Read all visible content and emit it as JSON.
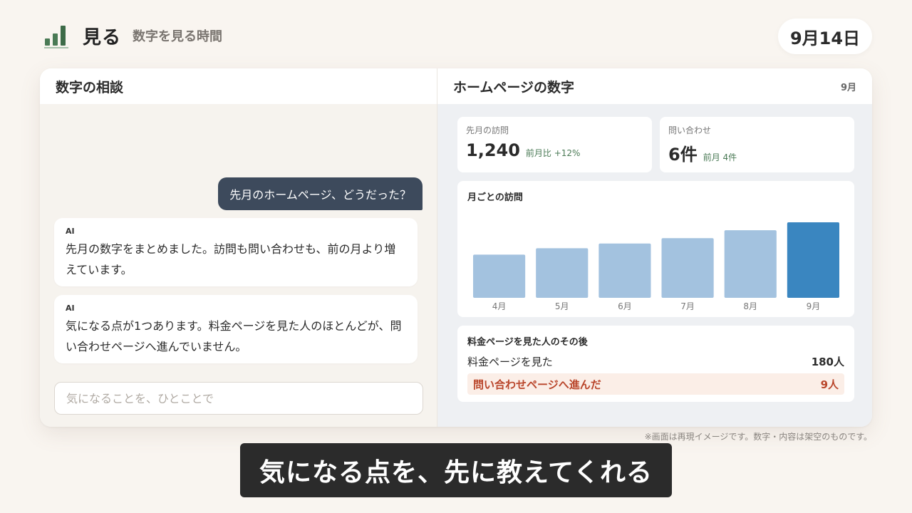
{
  "app": {
    "icon": "bar-chart-icon",
    "title": "見る",
    "subtitle": "数字を見る時間",
    "date": "9月14日"
  },
  "chat": {
    "header": "数字の相談",
    "user_message": "先月のホームページ、どうだった？",
    "ai_messages": [
      {
        "label": "AI",
        "text": "先月の数字をまとめました。訪問も問い合わせも、前の月より増えています。"
      },
      {
        "label": "AI",
        "text": "気になる点が1つあります。料金ページを見た人のほとんどが、問い合わせページへ進んでいません。"
      }
    ],
    "input_placeholder": "気になることを、ひとことで",
    "input_value": ""
  },
  "dashboard": {
    "title": "ホームページの数字",
    "month": "9月",
    "stats": [
      {
        "label": "先月の訪問",
        "value": "1,240",
        "delta": "前月比 +12%"
      },
      {
        "label": "問い合わせ",
        "value": "6件",
        "delta": "前月 4件"
      }
    ],
    "funnel": {
      "title": "料金ページを見た人のその後",
      "rows": [
        {
          "label": "料金ページを見た",
          "value": "180人"
        },
        {
          "label": "問い合わせページへ進んだ",
          "value": "9人"
        }
      ]
    }
  },
  "chart_data": {
    "type": "bar",
    "title": "月ごとの訪問",
    "categories": [
      "4月",
      "5月",
      "6月",
      "7月",
      "8月",
      "9月"
    ],
    "values": [
      600,
      690,
      755,
      830,
      940,
      1050
    ],
    "highlight_index": 5,
    "colors": {
      "bar": "#a3c2df",
      "highlight": "#3a86c0"
    },
    "ylim": [
      0,
      1050
    ],
    "grid": false
  },
  "footnote": "※画面は再現イメージです。数字・内容は架空のものです。",
  "caption": "気になる点を、先に教えてくれる"
}
